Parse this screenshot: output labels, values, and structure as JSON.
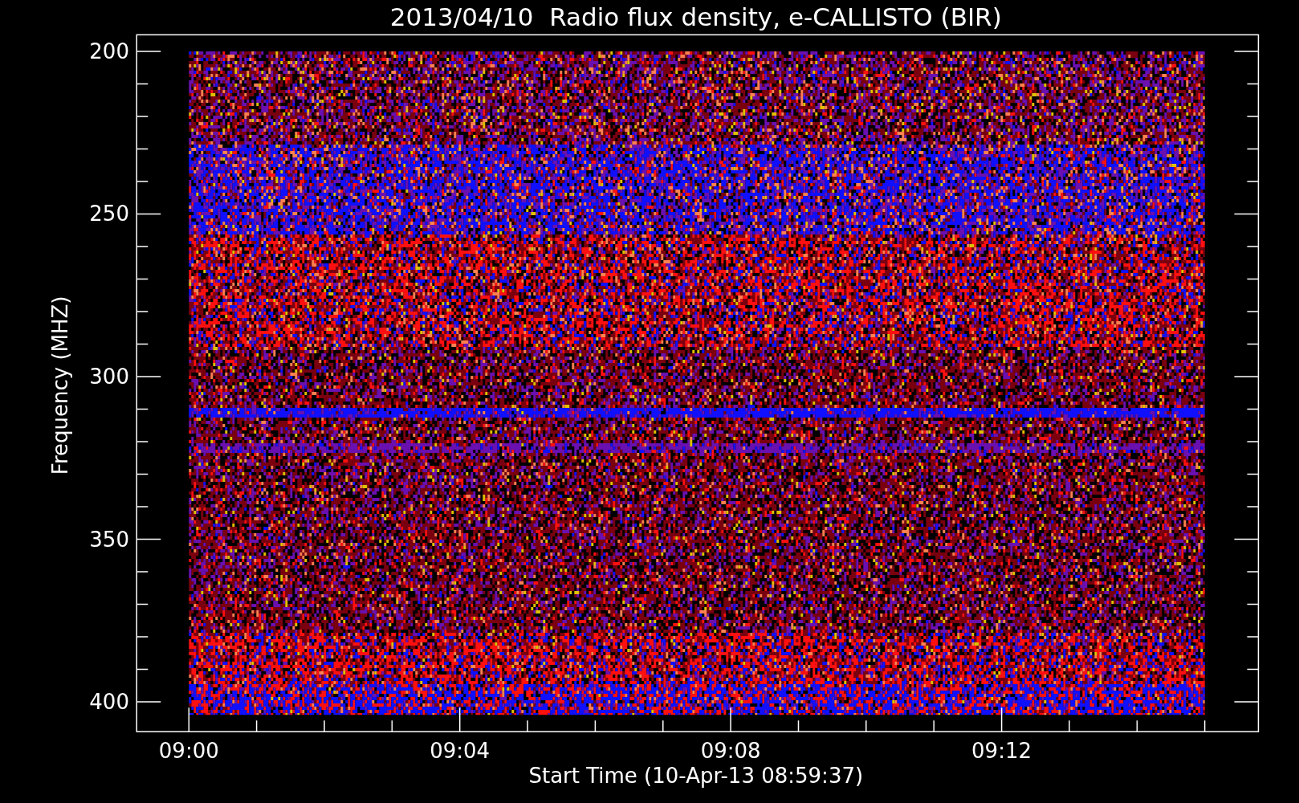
{
  "title": "2013/04/10  Radio flux density, e-CALLISTO (BIR)",
  "y_axis": {
    "label": "Frequency (MHZ)",
    "ticks": [
      "200",
      "250",
      "300",
      "350",
      "400"
    ]
  },
  "x_axis": {
    "label": "Start Time (10-Apr-13 08:59:37)",
    "ticks": [
      "09:00",
      "09:04",
      "09:08",
      "09:12"
    ]
  }
}
